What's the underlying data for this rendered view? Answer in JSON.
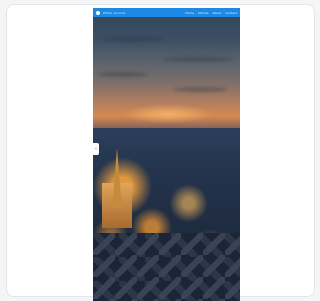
{
  "preview": {
    "brand": "Photo Journal",
    "nav": [
      "Home",
      "Stories",
      "About",
      "Contact"
    ],
    "image_alt": "City skyline at dusk with illuminated cathedral spire"
  },
  "colors": {
    "topbar": "#1e88e5",
    "card_border": "#e3e5e8",
    "background": "#f4f5f7"
  },
  "icons": {
    "side_tab": "chevron-left-icon",
    "logo": "logo-dot-icon"
  }
}
